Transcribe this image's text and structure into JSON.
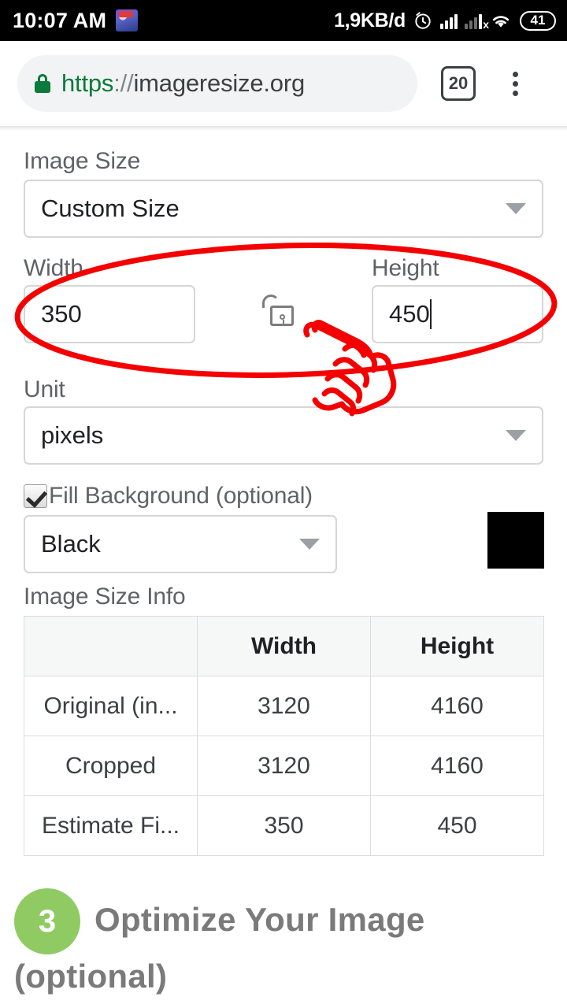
{
  "status_bar": {
    "time": "10:07 AM",
    "app_icon": "game-app-icon",
    "network_speed": "1,9KB/d",
    "alarm_icon": "alarm-clock-icon",
    "signal_icon": "signal-bars-icon",
    "signal_no_sim_icon": "signal-no-sim-icon",
    "wifi_icon": "wifi-icon",
    "battery_level": "41"
  },
  "browser": {
    "lock_icon": "secure-lock-icon",
    "url_scheme": "https",
    "url_separator": "://",
    "url_host": "imageresize.org",
    "tab_count": "20",
    "menu_icon": "kebab-menu-icon"
  },
  "form": {
    "image_size_label": "Image Size",
    "image_size_value": "Custom Size",
    "width_label": "Width",
    "width_value": "350",
    "lock_ratio_icon": "unlocked-padlock-icon",
    "height_label": "Height",
    "height_value": "450",
    "unit_label": "Unit",
    "unit_value": "pixels",
    "fill_background_label": "Fill Background (optional)",
    "fill_background_checked": true,
    "fill_color_value": "Black",
    "fill_color_hex": "#000000"
  },
  "table": {
    "title": "Image Size Info",
    "columns": [
      "",
      "Width",
      "Height"
    ],
    "rows": [
      {
        "name": "Original (in...",
        "width": "3120",
        "height": "4160"
      },
      {
        "name": "Cropped",
        "width": "3120",
        "height": "4160"
      },
      {
        "name": "Estimate Fi...",
        "width": "350",
        "height": "450"
      }
    ]
  },
  "step": {
    "number": "3",
    "title_line1": "Optimize Your Image",
    "title_line2": "(optional)",
    "badge_color": "#8fcb62"
  },
  "annotation": {
    "ellipse_color": "#f40000",
    "hand_icon": "pointing-hand-annotation"
  }
}
